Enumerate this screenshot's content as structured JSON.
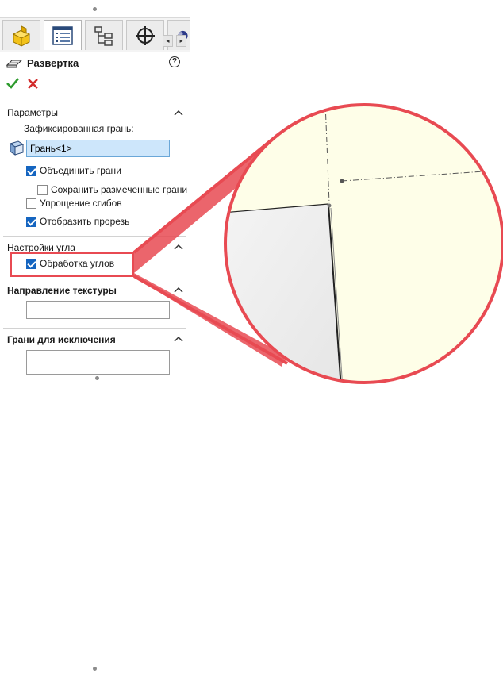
{
  "panel": {
    "title": "Развертка",
    "help_glyph": "?",
    "tabs": [
      {
        "name": "part-icon"
      },
      {
        "name": "property-manager-icon"
      },
      {
        "name": "configuration-tree-icon"
      },
      {
        "name": "dimxpert-icon"
      },
      {
        "name": "appearance-icon"
      }
    ],
    "nav_prev": "◂",
    "nav_next": "▸",
    "colors": {
      "accent": "#1565c0",
      "callout": "#e84a52",
      "zoom_fill": "#fefee8",
      "selection": "#cde6fb"
    }
  },
  "params": {
    "title": "Параметры",
    "fixed_face_label": "Зафиксированная грань:",
    "fixed_face_value": "Грань<1>",
    "merge_faces": {
      "label": "Объединить грани",
      "checked": true
    },
    "keep_marked_faces": {
      "label": "Сохранить размеченные грани",
      "checked": false
    },
    "simplify_bends": {
      "label": "Упрощение сгибов",
      "checked": false
    },
    "show_cut": {
      "label": "Отобразить прорезь",
      "checked": true
    }
  },
  "corner": {
    "title": "Настройки угла",
    "process_corners": {
      "label": "Обработка углов",
      "checked": true
    }
  },
  "texture": {
    "title": "Направление текстуры",
    "value": ""
  },
  "exclude": {
    "title": "Грани для исключения",
    "value": ""
  }
}
